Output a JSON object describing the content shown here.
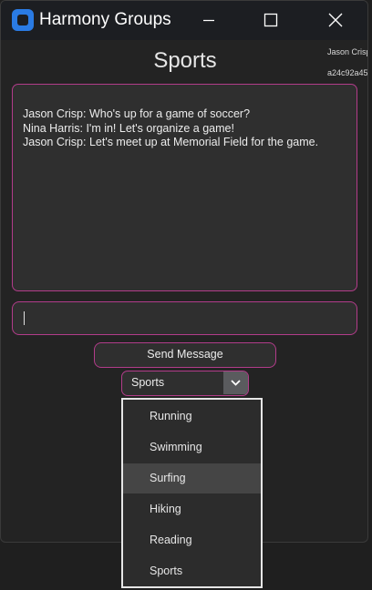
{
  "window": {
    "title": "Harmony Groups",
    "controls": {
      "minimize_icon": "minimize-icon",
      "maximize_icon": "maximize-icon",
      "close_icon": "close-icon"
    }
  },
  "user": {
    "name": "Jason Crisp",
    "id": "a24c92a45"
  },
  "group": {
    "title": "Sports"
  },
  "chat": {
    "messages": [
      "Jason Crisp: Who's up for a game of soccer?",
      "Nina Harris: I'm in! Let's organize a game!",
      "Jason Crisp: Let's meet up at Memorial Field for the game."
    ]
  },
  "message_input": {
    "value": ""
  },
  "send_button": {
    "label": "Send Message"
  },
  "group_select": {
    "selected": "Sports",
    "options": [
      "Running",
      "Swimming",
      "Surfing",
      "Hiking",
      "Reading",
      "Sports"
    ],
    "hovered_index": 2
  },
  "colors": {
    "accent_border": "#b23c8a",
    "app_icon": "#2a7be4",
    "background": "#232323"
  }
}
